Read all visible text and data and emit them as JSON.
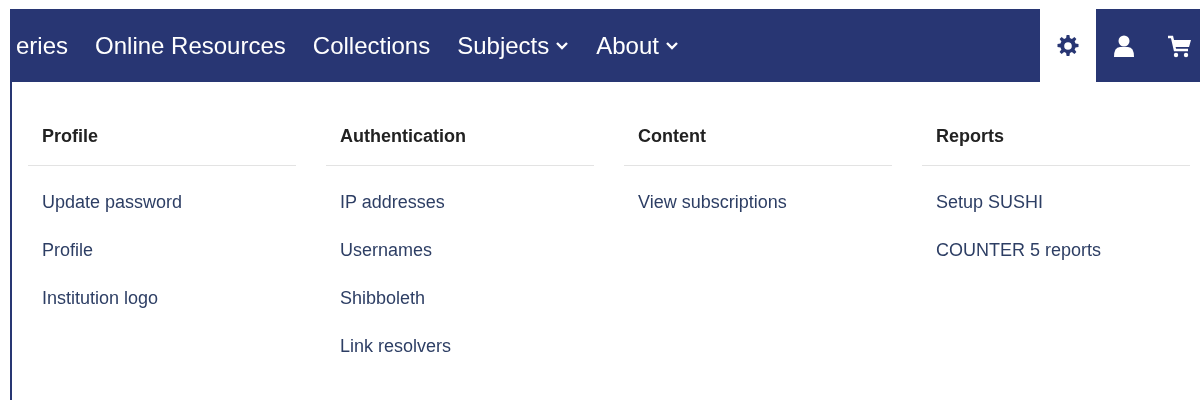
{
  "nav": {
    "items": [
      {
        "label": "eries",
        "dropdown": false
      },
      {
        "label": "Online Resources",
        "dropdown": false
      },
      {
        "label": "Collections",
        "dropdown": false
      },
      {
        "label": "Subjects",
        "dropdown": true
      },
      {
        "label": "About",
        "dropdown": true
      }
    ],
    "icon_tabs": [
      {
        "kind": "settings",
        "selected": true
      },
      {
        "kind": "user",
        "selected": false
      },
      {
        "kind": "cart",
        "selected": false
      }
    ]
  },
  "menu": {
    "columns": [
      {
        "heading": "Profile",
        "links": [
          "Update password",
          "Profile",
          "Institution logo"
        ]
      },
      {
        "heading": "Authentication",
        "links": [
          "IP addresses",
          "Usernames",
          "Shibboleth",
          "Link resolvers"
        ]
      },
      {
        "heading": "Content",
        "links": [
          "View subscriptions"
        ]
      },
      {
        "heading": "Reports",
        "links": [
          "Setup SUSHI",
          "COUNTER 5 reports"
        ]
      }
    ]
  }
}
